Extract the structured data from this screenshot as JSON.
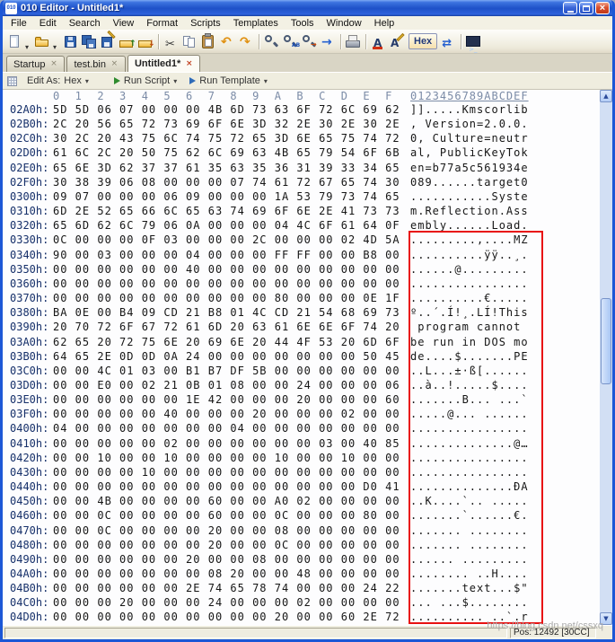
{
  "window": {
    "title": "010 Editor - Untitled1*",
    "app_icon_text": "010"
  },
  "glyphs": {
    "caret": "▾",
    "close": "×",
    "up": "▲",
    "down": "▼"
  },
  "menu": {
    "items": [
      "File",
      "Edit",
      "Search",
      "View",
      "Format",
      "Scripts",
      "Templates",
      "Tools",
      "Window",
      "Help"
    ]
  },
  "toolbar": {
    "hex_button": "Hex",
    "icons_a": [
      {
        "name": "new-file-icon",
        "cls": "i-new"
      },
      {
        "name": "new-file-dropdown-caret-icon",
        "cls": "i-caretd"
      },
      {
        "name": "open-file-icon",
        "cls": "i-open"
      },
      {
        "name": "open-file-dropdown-caret-icon",
        "cls": "i-caretd"
      },
      {
        "name": "save-icon",
        "cls": "i-save"
      },
      {
        "name": "save-all-icon",
        "cls": "i-saveall"
      },
      {
        "name": "save-copy-icon",
        "cls": "i-savecopy"
      },
      {
        "name": "export-icon",
        "cls": "i-export"
      },
      {
        "name": "import-icon",
        "cls": "i-import"
      },
      {
        "name": "toolbar-separator",
        "cls": "i-sep"
      },
      {
        "name": "cut-icon",
        "cls": "i-cut"
      },
      {
        "name": "copy-icon",
        "cls": "i-copy"
      },
      {
        "name": "paste-icon",
        "cls": "i-paste"
      },
      {
        "name": "undo-icon",
        "cls": "i-undo"
      },
      {
        "name": "redo-icon",
        "cls": "i-redo"
      },
      {
        "name": "toolbar-separator",
        "cls": "i-sep"
      },
      {
        "name": "find-icon",
        "cls": "i-find"
      },
      {
        "name": "replace-icon",
        "cls": "i-replace"
      },
      {
        "name": "goto-icon",
        "cls": "i-goto"
      },
      {
        "name": "navigate-icon",
        "cls": "i-nav"
      },
      {
        "name": "toolbar-separator",
        "cls": "i-sep"
      },
      {
        "name": "print-icon",
        "cls": "i-print"
      },
      {
        "name": "toolbar-separator",
        "cls": "i-sep"
      },
      {
        "name": "font-icon",
        "cls": "i-fonta"
      },
      {
        "name": "edit-font-icon",
        "cls": "i-fontb"
      }
    ],
    "icons_b": [
      {
        "name": "compare-icon",
        "cls": "i-compare"
      },
      {
        "name": "toolbar-separator",
        "cls": "i-sep"
      },
      {
        "name": "console-icon",
        "cls": "i-console"
      }
    ]
  },
  "tabs": [
    {
      "name": "tab-startup",
      "label": "Startup",
      "active": false
    },
    {
      "name": "tab-test-bin",
      "label": "test.bin",
      "active": false
    },
    {
      "name": "tab-untitled1",
      "label": "Untitled1*",
      "active": true
    }
  ],
  "editbar": {
    "edit_as_label": "Edit As:",
    "edit_as_value": "Hex",
    "run_script": "Run Script",
    "run_template": "Run Template"
  },
  "hexview": {
    "byte_header": "0  1  2  3  4  5  6  7  8  9  A  B  C  D  E  F",
    "ascii_header": "0123456789ABCDEF",
    "rows": [
      {
        "addr": "02A0h:",
        "hex": "5D 5D 06 07 00 00 00 4B 6D 73 63 6F 72 6C 69 62",
        "ascii": "]].....Kmscorlib"
      },
      {
        "addr": "02B0h:",
        "hex": "2C 20 56 65 72 73 69 6F 6E 3D 32 2E 30 2E 30 2E",
        "ascii": ", Version=2.0.0."
      },
      {
        "addr": "02C0h:",
        "hex": "30 2C 20 43 75 6C 74 75 72 65 3D 6E 65 75 74 72",
        "ascii": "0, Culture=neutr"
      },
      {
        "addr": "02D0h:",
        "hex": "61 6C 2C 20 50 75 62 6C 69 63 4B 65 79 54 6F 6B",
        "ascii": "al, PublicKeyTok"
      },
      {
        "addr": "02E0h:",
        "hex": "65 6E 3D 62 37 37 61 35 63 35 36 31 39 33 34 65",
        "ascii": "en=b77a5c561934e"
      },
      {
        "addr": "02F0h:",
        "hex": "30 38 39 06 08 00 00 00 07 74 61 72 67 65 74 30",
        "ascii": "089......target0"
      },
      {
        "addr": "0300h:",
        "hex": "09 07 00 00 00 06 09 00 00 00 1A 53 79 73 74 65",
        "ascii": "...........Syste"
      },
      {
        "addr": "0310h:",
        "hex": "6D 2E 52 65 66 6C 65 63 74 69 6F 6E 2E 41 73 73",
        "ascii": "m.Reflection.Ass"
      },
      {
        "addr": "0320h:",
        "hex": "65 6D 62 6C 79 06 0A 00 00 00 04 4C 6F 61 64 0F",
        "ascii": "embly......Load."
      },
      {
        "addr": "0330h:",
        "hex": "0C 00 00 00 0F 03 00 00 00 2C 00 00 00 02 4D 5A",
        "ascii": ".........,....MZ"
      },
      {
        "addr": "0340h:",
        "hex": "90 00 03 00 00 00 04 00 00 00 FF FF 00 00 B8 00",
        "ascii": "..........ÿÿ..¸."
      },
      {
        "addr": "0350h:",
        "hex": "00 00 00 00 00 00 40 00 00 00 00 00 00 00 00 00",
        "ascii": "......@........."
      },
      {
        "addr": "0360h:",
        "hex": "00 00 00 00 00 00 00 00 00 00 00 00 00 00 00 00",
        "ascii": "................"
      },
      {
        "addr": "0370h:",
        "hex": "00 00 00 00 00 00 00 00 00 00 80 00 00 00 0E 1F",
        "ascii": "..........€....."
      },
      {
        "addr": "0380h:",
        "hex": "BA 0E 00 B4 09 CD 21 B8 01 4C CD 21 54 68 69 73",
        "ascii": "º..´.Í!¸.LÍ!This"
      },
      {
        "addr": "0390h:",
        "hex": "20 70 72 6F 67 72 61 6D 20 63 61 6E 6E 6F 74 20",
        "ascii": " program cannot "
      },
      {
        "addr": "03A0h:",
        "hex": "62 65 20 72 75 6E 20 69 6E 20 44 4F 53 20 6D 6F",
        "ascii": "be run in DOS mo"
      },
      {
        "addr": "03B0h:",
        "hex": "64 65 2E 0D 0D 0A 24 00 00 00 00 00 00 00 50 45",
        "ascii": "de....$.......PE"
      },
      {
        "addr": "03C0h:",
        "hex": "00 00 4C 01 03 00 B1 B7 DF 5B 00 00 00 00 00 00",
        "ascii": "..L...±·ß[......"
      },
      {
        "addr": "03D0h:",
        "hex": "00 00 E0 00 02 21 0B 01 08 00 00 24 00 00 00 06",
        "ascii": "..à..!.....$...."
      },
      {
        "addr": "03E0h:",
        "hex": "00 00 00 00 00 00 1E 42 00 00 00 20 00 00 00 60",
        "ascii": ".......B... ...`"
      },
      {
        "addr": "03F0h:",
        "hex": "00 00 00 00 00 40 00 00 00 20 00 00 00 02 00 00",
        "ascii": ".....@... ......"
      },
      {
        "addr": "0400h:",
        "hex": "04 00 00 00 00 00 00 00 04 00 00 00 00 00 00 00",
        "ascii": "................"
      },
      {
        "addr": "0410h:",
        "hex": "00 00 00 00 00 02 00 00 00 00 00 00 03 00 40 85",
        "ascii": "..............@…"
      },
      {
        "addr": "0420h:",
        "hex": "00 00 10 00 00 10 00 00 00 00 10 00 00 10 00 00",
        "ascii": "................"
      },
      {
        "addr": "0430h:",
        "hex": "00 00 00 00 10 00 00 00 00 00 00 00 00 00 00 00",
        "ascii": "................"
      },
      {
        "addr": "0440h:",
        "hex": "00 00 00 00 00 00 00 00 00 00 00 00 00 00 D0 41",
        "ascii": "..............ÐA"
      },
      {
        "addr": "0450h:",
        "hex": "00 00 4B 00 00 00 00 60 00 00 A0 02 00 00 00 00",
        "ascii": "..K....`.. ....."
      },
      {
        "addr": "0460h:",
        "hex": "00 00 0C 00 00 00 00 60 00 00 0C 00 00 00 80 00",
        "ascii": ".......`......€."
      },
      {
        "addr": "0470h:",
        "hex": "00 00 0C 00 00 00 00 20 00 00 08 00 00 00 00 00",
        "ascii": "....... ........"
      },
      {
        "addr": "0480h:",
        "hex": "00 00 00 00 00 00 00 20 00 00 0C 00 00 00 00 00",
        "ascii": "....... ........"
      },
      {
        "addr": "0490h:",
        "hex": "00 00 00 00 00 00 20 00 00 08 00 00 00 00 00 00",
        "ascii": "...... ........."
      },
      {
        "addr": "04A0h:",
        "hex": "00 00 00 00 00 00 00 08 20 00 00 48 00 00 00 00",
        "ascii": "........ ..H...."
      },
      {
        "addr": "04B0h:",
        "hex": "00 00 00 00 00 00 2E 74 65 78 74 00 00 00 24 22",
        "ascii": ".......text...$\""
      },
      {
        "addr": "04C0h:",
        "hex": "00 00 00 20 00 00 00 24 00 00 00 02 00 00 00 00",
        "ascii": "... ...$........"
      },
      {
        "addr": "04D0h:",
        "hex": "00 00 00 00 00 00 00 00 00 00 20 00 00 60 2E 72",
        "ascii": ".......... ..`.r"
      }
    ]
  },
  "statusbar": {
    "position": "Pos: 12492 [30CC]"
  },
  "watermark": "https://blog.csdn.net/cssxq"
}
